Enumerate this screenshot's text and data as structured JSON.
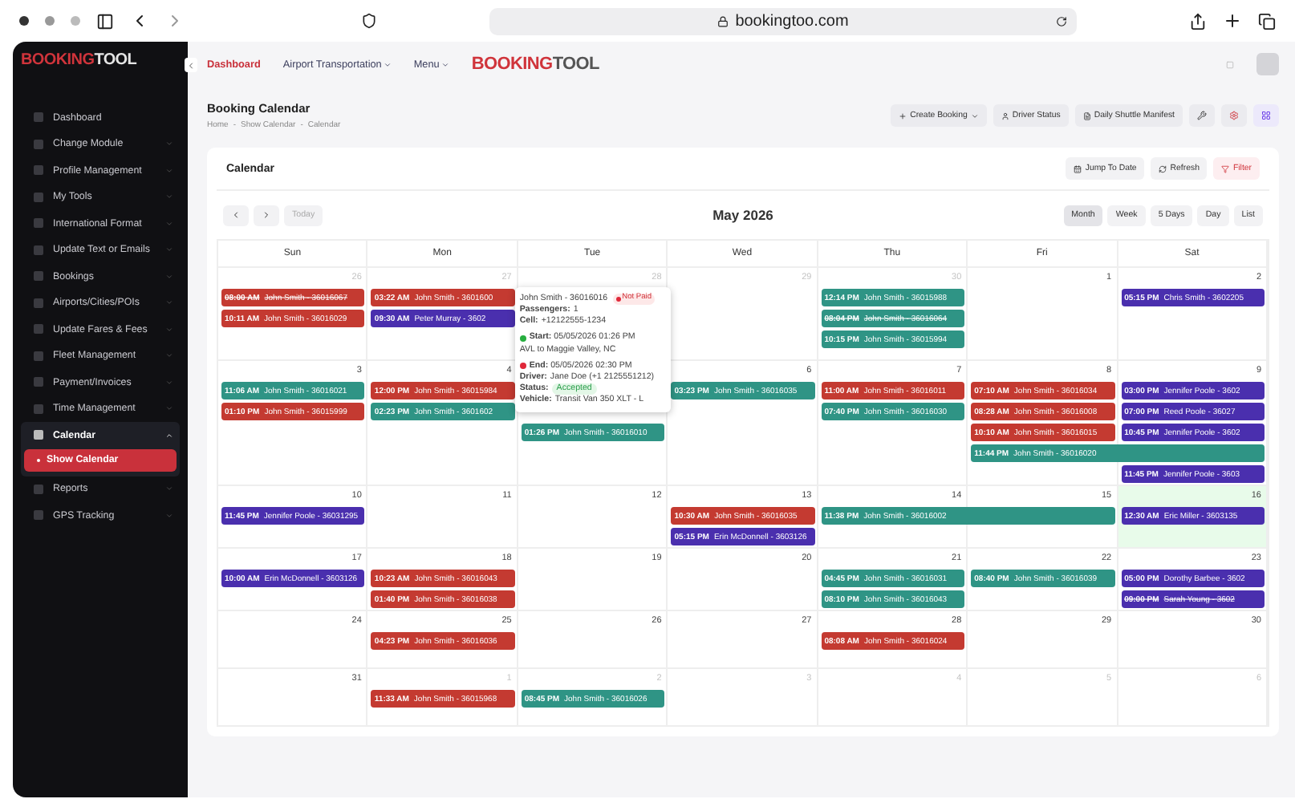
{
  "browser": {
    "url": "bookingtoo.com"
  },
  "sidebar": {
    "logo": {
      "part_1": "BOOKING",
      "part_2": "TOOL"
    },
    "items": [
      {
        "label": "Dashboard",
        "kind": "link",
        "expanded": false
      },
      {
        "label": "Change Module",
        "kind": "menu",
        "expanded": false
      },
      {
        "label": "Profile Management",
        "kind": "menu",
        "expanded": false
      },
      {
        "label": "My Tools",
        "kind": "menu",
        "expanded": false
      },
      {
        "label": "International Format",
        "kind": "menu",
        "expanded": false
      },
      {
        "label": "Update Text or Emails",
        "kind": "menu",
        "expanded": false
      },
      {
        "label": "Bookings",
        "kind": "menu",
        "expanded": false
      },
      {
        "label": "Airports/Cities/POIs",
        "kind": "menu",
        "expanded": false
      },
      {
        "label": "Update Fares & Fees",
        "kind": "menu",
        "expanded": false
      },
      {
        "label": "Fleet Management",
        "kind": "menu",
        "expanded": false
      },
      {
        "label": "Payment/Invoices",
        "kind": "menu",
        "expanded": false
      },
      {
        "label": "Time Management",
        "kind": "menu",
        "expanded": false
      },
      {
        "label": "Calendar",
        "kind": "menu",
        "expanded": true,
        "children": [
          {
            "label": "Show Calendar",
            "selected": true
          }
        ]
      },
      {
        "label": "Reports",
        "kind": "menu",
        "expanded": false
      },
      {
        "label": "GPS Tracking",
        "kind": "menu",
        "expanded": false
      }
    ]
  },
  "top_nav": {
    "items": [
      {
        "label": "Dashboard",
        "kind": "link",
        "selected": true
      },
      {
        "label": "Airport Transportation",
        "kind": "menu",
        "selected": false
      },
      {
        "label": "Menu",
        "kind": "menu",
        "selected": false
      }
    ],
    "logo": {
      "part_1": "BOOKING",
      "part_2": "TOOL"
    }
  },
  "page": {
    "title": "Booking Calendar",
    "breadcrumb": [
      "Home",
      "-",
      "Show Calendar",
      "-",
      "Calendar"
    ],
    "actions": [
      {
        "label": "Create Booking",
        "kind": "create"
      },
      {
        "label": "Driver Status",
        "kind": "driver"
      },
      {
        "label": "Daily Shuttle Manifest",
        "kind": "manifest"
      }
    ]
  },
  "calendar": {
    "title": "Calendar",
    "tools": [
      {
        "label": "Jump To Date",
        "kind": "jump"
      },
      {
        "label": "Refresh",
        "kind": "refresh"
      },
      {
        "label": "Filter",
        "kind": "filter"
      }
    ],
    "today_button": {
      "label": "Today",
      "disabled": true
    },
    "month": "May 2026",
    "views": [
      {
        "label": "Month",
        "selected": true
      },
      {
        "label": "Week",
        "selected": false
      },
      {
        "label": "5 Days",
        "selected": false
      },
      {
        "label": "Day",
        "selected": false
      },
      {
        "label": "List",
        "selected": false
      }
    ],
    "weekdays": [
      "Sun",
      "Mon",
      "Tue",
      "Wed",
      "Thu",
      "Fri",
      "Sat"
    ],
    "weeks": [
      {
        "days": [
          {
            "label": "26",
            "outside": true,
            "today": false,
            "events": [
              {
                "kind": "single",
                "time": "08:00 AM",
                "title": "John Smith - 36016067",
                "color": "#c43a31",
                "cancelled": true
              },
              {
                "kind": "single",
                "time": "10:11 AM",
                "title": "John Smith - 36016029",
                "color": "#c43a31",
                "cancelled": false
              }
            ]
          },
          {
            "label": "27",
            "outside": true,
            "today": false,
            "events": [
              {
                "kind": "single",
                "time": "03:22 AM",
                "title": "John Smith - 3601600",
                "color": "#c43a31",
                "cancelled": false
              },
              {
                "kind": "single",
                "time": "09:30 AM",
                "title": "Peter Murray - 3602",
                "color": "#4a2fae",
                "cancelled": false
              }
            ]
          },
          {
            "label": "28",
            "outside": true,
            "today": false
          },
          {
            "label": "29",
            "outside": true,
            "today": false
          },
          {
            "label": "30",
            "outside": true,
            "today": false,
            "events": [
              {
                "kind": "single",
                "time": "12:14 PM",
                "title": "John Smith - 36015988",
                "color": "#2f9485",
                "cancelled": false
              },
              {
                "kind": "single",
                "time": "08:04 PM",
                "title": "John Smith - 36016064",
                "color": "#2f9485",
                "cancelled": true
              },
              {
                "kind": "single",
                "time": "10:15 PM",
                "title": "John Smith - 36015994",
                "color": "#2f9485",
                "cancelled": false
              }
            ]
          },
          {
            "label": "1",
            "outside": false,
            "today": false
          },
          {
            "label": "2",
            "outside": false,
            "today": false,
            "events": [
              {
                "kind": "single",
                "time": "05:15 PM",
                "title": "Chris Smith - 3602205",
                "color": "#4a2fae",
                "cancelled": false
              }
            ]
          }
        ]
      },
      {
        "days": [
          {
            "label": "3",
            "outside": false,
            "today": false,
            "events": [
              {
                "kind": "single",
                "time": "11:06 AM",
                "title": "John Smith - 36016021",
                "color": "#2f9485",
                "cancelled": false
              },
              {
                "kind": "single",
                "time": "01:10 PM",
                "title": "John Smith - 36015999",
                "color": "#c43a31",
                "cancelled": false
              }
            ]
          },
          {
            "label": "4",
            "outside": false,
            "today": false,
            "events": [
              {
                "kind": "single",
                "time": "12:00 PM",
                "title": "John Smith - 36015984",
                "color": "#c43a31",
                "cancelled": false
              },
              {
                "kind": "single",
                "time": "02:23 PM",
                "title": "John Smith - 3601602",
                "color": "#2f9485",
                "cancelled": false
              }
            ]
          },
          {
            "today": false,
            "events": [
              {
                "kind": "single",
                "time": "01:26 PM",
                "title": "John Smith - 36016010",
                "color": "#2f9485",
                "cancelled": false
              }
            ]
          },
          {
            "label": "6",
            "outside": false,
            "today": false,
            "events": [
              {
                "kind": "single",
                "time": "03:23 PM",
                "title": "John Smith - 36016035",
                "color": "#2f9485",
                "cancelled": false
              }
            ]
          },
          {
            "label": "7",
            "outside": false,
            "today": false,
            "events": [
              {
                "kind": "single",
                "time": "11:00 AM",
                "title": "John Smith - 36016011",
                "color": "#c43a31",
                "cancelled": false
              },
              {
                "kind": "single",
                "time": "07:40 PM",
                "title": "John Smith - 36016030",
                "color": "#2f9485",
                "cancelled": false
              }
            ]
          },
          {
            "label": "8",
            "outside": false,
            "today": false,
            "events": [
              {
                "kind": "single",
                "time": "07:10 AM",
                "title": "John Smith - 36016034",
                "color": "#c43a31",
                "cancelled": false
              },
              {
                "kind": "single",
                "time": "08:28 AM",
                "title": "John Smith - 36016008",
                "color": "#c43a31",
                "cancelled": false
              },
              {
                "kind": "single",
                "time": "10:10 AM",
                "title": "John Smith - 36016015",
                "color": "#c43a31",
                "cancelled": false
              },
              {
                "kind": "two_day",
                "time": "11:44 PM",
                "title": "John Smith - 36016020",
                "color": "#2f9485",
                "cancelled": false
              }
            ]
          },
          {
            "label": "9",
            "outside": false,
            "today": false,
            "events": [
              {
                "kind": "single",
                "time": "03:00 PM",
                "title": "Jennifer Poole - 3602",
                "color": "#4a2fae",
                "cancelled": false
              },
              {
                "kind": "single",
                "time": "07:00 PM",
                "title": "Reed Poole - 36027",
                "color": "#4a2fae",
                "cancelled": false
              },
              {
                "kind": "single",
                "time": "10:45 PM",
                "title": "Jennifer Poole - 3602",
                "color": "#4a2fae",
                "cancelled": false
              },
              {
                "kind": "single",
                "time": "11:45 PM",
                "title": "Jennifer Poole - 3603",
                "color": "#4a2fae",
                "cancelled": false
              }
            ]
          }
        ]
      },
      {
        "days": [
          {
            "label": "10",
            "outside": false,
            "today": false,
            "events": [
              {
                "kind": "single",
                "time": "11:45 PM",
                "title": "Jennifer Poole - 36031295",
                "color": "#4a2fae",
                "cancelled": false
              }
            ]
          },
          {
            "label": "11",
            "outside": false,
            "today": false
          },
          {
            "label": "12",
            "outside": false,
            "today": false
          },
          {
            "label": "13",
            "outside": false,
            "today": false,
            "events": [
              {
                "kind": "single",
                "time": "10:30 AM",
                "title": "John Smith - 36016035",
                "color": "#c43a31",
                "cancelled": false
              },
              {
                "kind": "single",
                "time": "05:15 PM",
                "title": "Erin McDonnell - 3603126",
                "color": "#4a2fae",
                "cancelled": false
              }
            ]
          },
          {
            "label": "14",
            "outside": false,
            "today": false,
            "events": [
              {
                "kind": "two_day",
                "time": "11:38 PM",
                "title": "John Smith - 36016002",
                "color": "#2f9485",
                "cancelled": false
              }
            ]
          },
          {
            "label": "15",
            "outside": false,
            "today": false
          },
          {
            "label": "16",
            "outside": false,
            "today": true,
            "events": [
              {
                "kind": "single",
                "time": "12:30 AM",
                "title": "Eric Miller - 3603135",
                "color": "#4a2fae",
                "cancelled": false
              }
            ]
          }
        ]
      },
      {
        "days": [
          {
            "label": "17",
            "outside": false,
            "today": false,
            "events": [
              {
                "kind": "single",
                "time": "10:00 AM",
                "title": "Erin McDonnell - 3603126",
                "color": "#4a2fae",
                "cancelled": false
              }
            ]
          },
          {
            "label": "18",
            "outside": false,
            "today": false,
            "events": [
              {
                "kind": "single",
                "time": "10:23 AM",
                "title": "John Smith - 36016043",
                "color": "#c43a31",
                "cancelled": false
              },
              {
                "kind": "single",
                "time": "01:40 PM",
                "title": "John Smith - 36016038",
                "color": "#c43a31",
                "cancelled": false
              }
            ]
          },
          {
            "label": "19",
            "outside": false,
            "today": false
          },
          {
            "label": "20",
            "outside": false,
            "today": false
          },
          {
            "label": "21",
            "outside": false,
            "today": false,
            "events": [
              {
                "kind": "single",
                "time": "04:45 PM",
                "title": "John Smith - 36016031",
                "color": "#2f9485",
                "cancelled": false
              },
              {
                "kind": "single",
                "time": "08:10 PM",
                "title": "John Smith - 36016043",
                "color": "#2f9485",
                "cancelled": false
              }
            ]
          },
          {
            "label": "22",
            "outside": false,
            "today": false,
            "events": [
              {
                "kind": "single",
                "time": "08:40 PM",
                "title": "John Smith - 36016039",
                "color": "#2f9485",
                "cancelled": false
              }
            ]
          },
          {
            "label": "23",
            "outside": false,
            "today": false,
            "events": [
              {
                "kind": "single",
                "time": "05:00 PM",
                "title": "Dorothy Barbee - 3602",
                "color": "#4a2fae",
                "cancelled": false
              },
              {
                "kind": "single",
                "time": "09:00 PM",
                "title": "Sarah Young - 3602",
                "color": "#4a2fae",
                "cancelled": true
              }
            ]
          }
        ]
      },
      {
        "days": [
          {
            "label": "24",
            "outside": false,
            "today": false
          },
          {
            "label": "25",
            "outside": false,
            "today": false,
            "events": [
              {
                "kind": "single",
                "time": "04:23 PM",
                "title": "John Smith - 36016036",
                "color": "#c43a31",
                "cancelled": false
              }
            ]
          },
          {
            "label": "26",
            "outside": false,
            "today": false
          },
          {
            "label": "27",
            "outside": false,
            "today": false
          },
          {
            "label": "28",
            "outside": false,
            "today": false,
            "events": [
              {
                "kind": "single",
                "time": "08:08 AM",
                "title": "John Smith - 36016024",
                "color": "#c43a31",
                "cancelled": false
              }
            ]
          },
          {
            "label": "29",
            "outside": false,
            "today": false
          },
          {
            "label": "30",
            "outside": false,
            "today": false
          }
        ]
      },
      {
        "days": [
          {
            "label": "31",
            "outside": false,
            "today": false
          },
          {
            "label": "1",
            "outside": true,
            "today": false,
            "events": [
              {
                "kind": "single",
                "time": "11:33 AM",
                "title": "John Smith - 36015968",
                "color": "#c43a31",
                "cancelled": false
              }
            ]
          },
          {
            "label": "2",
            "outside": true,
            "today": false,
            "events": [
              {
                "kind": "single",
                "time": "08:45 PM",
                "title": "John Smith - 36016026",
                "color": "#2f9485",
                "cancelled": false
              }
            ]
          },
          {
            "label": "3",
            "outside": true,
            "today": false
          },
          {
            "label": "4",
            "outside": true,
            "today": false
          },
          {
            "label": "5",
            "outside": true,
            "today": false
          },
          {
            "label": "6",
            "outside": true,
            "today": false
          }
        ]
      }
    ],
    "popover": {
      "title": "John Smith - 36016016",
      "badge": "Not Paid",
      "lines": [
        {
          "kind": "field",
          "label": "Passengers:",
          "value": "1"
        },
        {
          "kind": "field",
          "label": "Cell:",
          "value": "+12122555-1234"
        },
        {
          "kind": "start",
          "label": "Start:",
          "value": "05/05/2026 01:26 PM"
        },
        {
          "kind": "note",
          "value": "AVL to Maggie Valley, NC"
        },
        {
          "kind": "end",
          "label": "End:",
          "value": "05/05/2026 02:30 PM"
        },
        {
          "kind": "field",
          "label": "Driver:",
          "value": "Jane Doe (+1 2125551212)"
        },
        {
          "kind": "status",
          "label": "Status:",
          "value": "Accepted"
        },
        {
          "kind": "field",
          "label": "Vehicle:",
          "value": "Transit Van 350 XLT - L"
        }
      ]
    }
  }
}
